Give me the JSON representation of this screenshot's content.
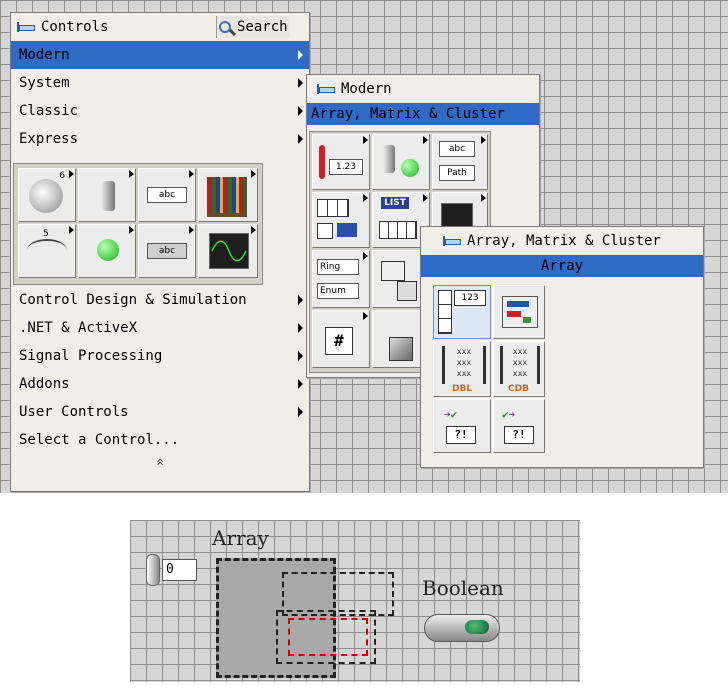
{
  "controls_palette": {
    "title": "Controls",
    "search_label": "Search",
    "items": [
      {
        "label": "Modern",
        "has_submenu": true,
        "highlighted": true
      },
      {
        "label": "System",
        "has_submenu": true
      },
      {
        "label": "Classic",
        "has_submenu": true
      },
      {
        "label": "Express",
        "has_submenu": true
      }
    ],
    "express_icons": [
      {
        "name": "numeric-knob-icon",
        "text": "6"
      },
      {
        "name": "toggle-switch-icon",
        "text": ""
      },
      {
        "name": "string-indicator-icon",
        "text": "abc"
      },
      {
        "name": "books-icon",
        "text": ""
      },
      {
        "name": "slide-gauge-icon",
        "text": "5"
      },
      {
        "name": "led-indicator-icon",
        "text": ""
      },
      {
        "name": "string-control-icon",
        "text": "abc"
      },
      {
        "name": "graph-indicator-icon",
        "text": ""
      }
    ],
    "bottom_items": [
      {
        "label": "Control Design & Simulation",
        "has_submenu": true
      },
      {
        "label": ".NET & ActiveX",
        "has_submenu": true
      },
      {
        "label": "Signal Processing",
        "has_submenu": true
      },
      {
        "label": "Addons",
        "has_submenu": true
      },
      {
        "label": "User Controls",
        "has_submenu": true
      },
      {
        "label": "Select a Control...",
        "has_submenu": false
      }
    ],
    "expand_glyph": "«"
  },
  "modern_palette": {
    "title": "Modern",
    "selected": "Array, Matrix & Cluster",
    "icon_texts": {
      "numeric": "1.23",
      "string": "abc",
      "path": "Path",
      "list": "LIST",
      "ring": "Ring",
      "enum": "Enum",
      "refnum": "#"
    }
  },
  "array_palette": {
    "title": "Array, Matrix & Cluster",
    "selected": "Array",
    "icon_texts": {
      "array_num": "123",
      "matrix_dbl": "DBL",
      "matrix_cdb": "CDB",
      "variant": "?!"
    }
  },
  "front_panel": {
    "array_label": "Array",
    "index_value": "0",
    "boolean_label": "Boolean"
  },
  "colors": {
    "highlight": "#316ac5",
    "grid_background": "#d6d6d6",
    "grid_lines": "#8f8f8f",
    "panel_background": "#f0eee6",
    "dashed_selection_red": "#cc0000"
  }
}
